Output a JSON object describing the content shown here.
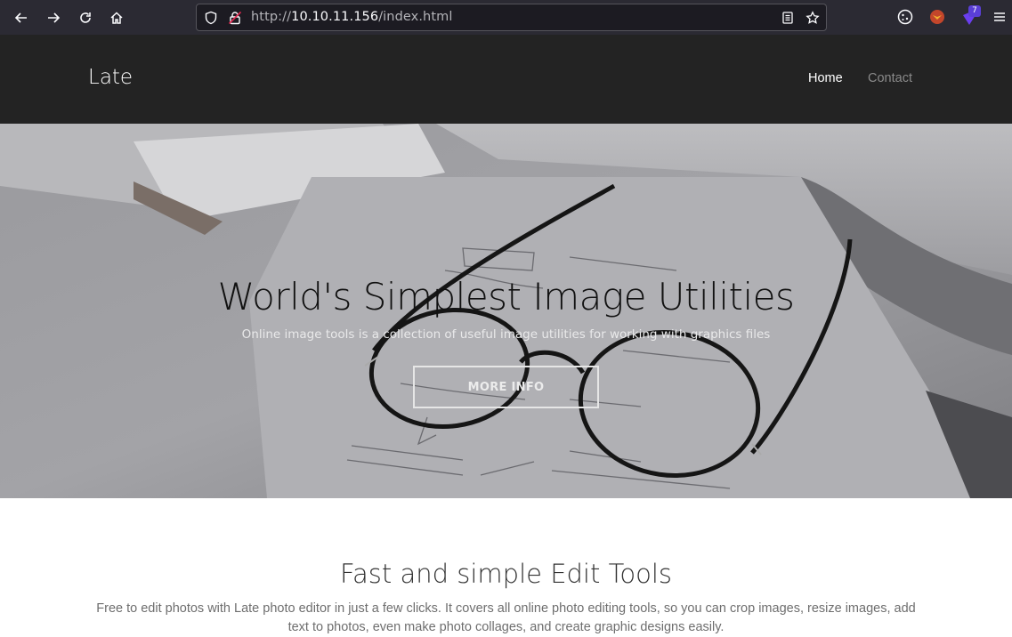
{
  "browser": {
    "url_prefix": "http://",
    "url_host": "10.10.11.156",
    "url_path": "/index.html",
    "extension_badge": "7"
  },
  "header": {
    "brand": "Late",
    "nav": [
      {
        "label": "Home",
        "active": true
      },
      {
        "label": "Contact",
        "active": false
      }
    ]
  },
  "hero": {
    "title": "World's Simplest Image Utilities",
    "subtitle": "Online image tools is a collection of useful image utilities for working with graphics files",
    "button": "MORE INFO"
  },
  "section": {
    "title": "Fast and simple Edit Tools",
    "text": "Free to edit photos with Late photo editor in just a few clicks. It covers all online photo editing tools, so you can crop images, resize images, add text to photos, even make photo collages, and create graphic designs easily."
  },
  "colors": {
    "browser_bar": "#2b2a33",
    "header": "#232323",
    "accent_text": "#333333"
  }
}
